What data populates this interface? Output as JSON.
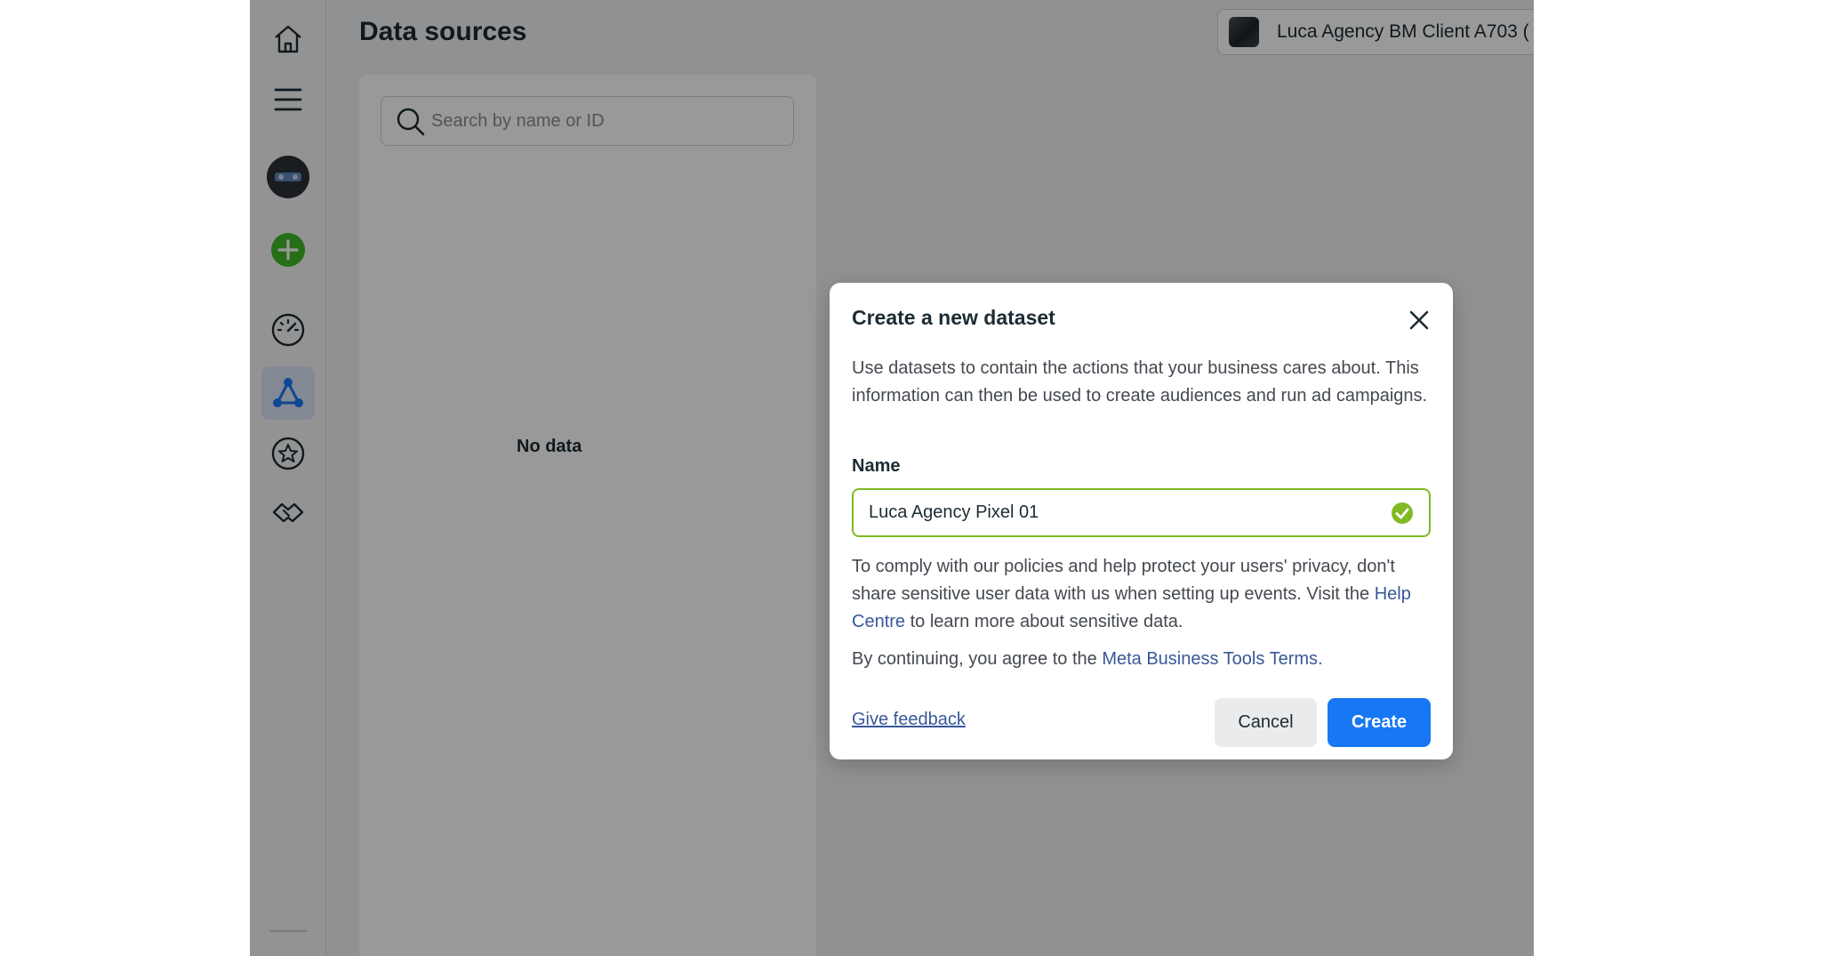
{
  "header": {
    "page_title": "Data sources",
    "account_name": "Luca Agency BM Client A703 ("
  },
  "sidebar": {
    "items": [
      {
        "name": "home",
        "icon": "home-icon"
      },
      {
        "name": "menu",
        "icon": "hamburger-menu-icon"
      },
      {
        "name": "business-avatar",
        "icon": "business-avatar"
      },
      {
        "name": "create",
        "icon": "plus-circle-icon"
      },
      {
        "name": "dashboard",
        "icon": "speedometer-icon"
      },
      {
        "name": "data-sources",
        "icon": "connected-nodes-icon",
        "active": true
      },
      {
        "name": "favorites",
        "icon": "star-circle-icon"
      },
      {
        "name": "partners",
        "icon": "handshake-icon"
      }
    ]
  },
  "list_panel": {
    "search_placeholder": "Search by name or ID",
    "empty_text": "No data"
  },
  "dialog": {
    "title": "Create a new dataset",
    "description": "Use datasets to contain the actions that your business cares about. This information can then be used to create audiences and run ad campaigns.",
    "name_label": "Name",
    "name_value": "Luca Agency Pixel 01",
    "privacy_before": "To comply with our policies and help protect your users' privacy, don't share sensitive user data with us when setting up events. Visit the ",
    "privacy_link": "Help Centre",
    "privacy_after": " to learn more about sensitive data.",
    "terms_before": "By continuing, you agree to the ",
    "terms_link": "Meta Business Tools Terms.",
    "feedback_label": "Give feedback",
    "cancel_label": "Cancel",
    "create_label": "Create"
  },
  "colors": {
    "primary": "#1877f2",
    "link": "#385898",
    "valid": "#7fba24",
    "add_green": "#42b72a"
  }
}
